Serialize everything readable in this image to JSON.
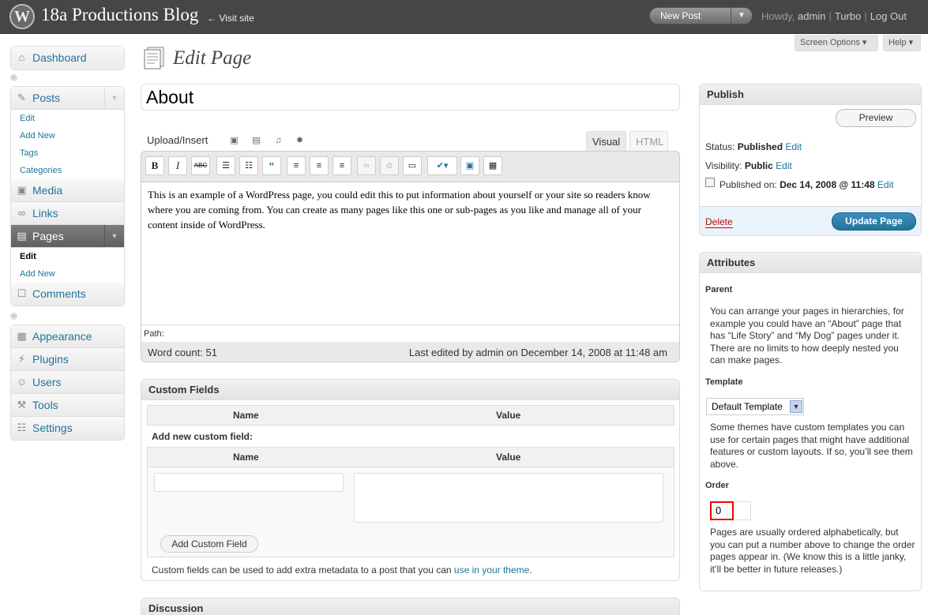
{
  "header": {
    "blog_title": "18a Productions Blog",
    "visit_site": "← Visit site",
    "new_post": "New Post",
    "howdy": "Howdy,",
    "user": "admin",
    "turbo": "Turbo",
    "logout": "Log Out",
    "sep": "|"
  },
  "screen_meta": {
    "screen_options": "Screen Options ▾",
    "help": "Help ▾"
  },
  "menu": {
    "dashboard": "Dashboard",
    "posts": "Posts",
    "posts_sub": [
      "Edit",
      "Add New",
      "Tags",
      "Categories"
    ],
    "media": "Media",
    "links": "Links",
    "pages": "Pages",
    "pages_sub": [
      "Edit",
      "Add New"
    ],
    "comments": "Comments",
    "appearance": "Appearance",
    "plugins": "Plugins",
    "users": "Users",
    "tools": "Tools",
    "settings": "Settings"
  },
  "page": {
    "title": "Edit Page"
  },
  "post": {
    "title": "About"
  },
  "editor": {
    "upload_insert": "Upload/Insert",
    "tab_visual": "Visual",
    "tab_html": "HTML",
    "content": "This is an example of a WordPress page, you could edit this to put information about yourself or your site so readers know where you are coming from. You can create as many pages like this one or sub-pages as you like and manage all of your content inside of WordPress.",
    "path": "Path:",
    "word_count": "Word count: 51",
    "last_edited": "Last edited by admin on December 14, 2008 at 11:48 am"
  },
  "custom_fields": {
    "title": "Custom Fields",
    "col_name": "Name",
    "col_value": "Value",
    "add_new_label": "Add new custom field:",
    "add_button": "Add Custom Field",
    "note_prefix": "Custom fields can be used to add extra metadata to a post that you can",
    "note_link": "use in your theme",
    "note_suffix": "."
  },
  "discussion": {
    "title": "Discussion"
  },
  "publish": {
    "title": "Publish",
    "preview": "Preview",
    "status_label": "Status:",
    "status_value": "Published",
    "visibility_label": "Visibility:",
    "visibility_value": "Public",
    "published_label": "Published on:",
    "published_value": "Dec 14, 2008 @ 11:48",
    "edit": "Edit",
    "delete": "Delete",
    "update": "Update Page"
  },
  "attributes": {
    "title": "Attributes",
    "parent_label": "Parent",
    "parent_help": "You can arrange your pages in hierarchies, for example you could have an “About” page that has “Life Story” and “My Dog” pages under it. There are no limits to how deeply nested you can make pages.",
    "template_label": "Template",
    "template_value": "Default Template",
    "template_help": "Some themes have custom templates you can use for certain pages that might have additional features or custom layouts. If so, you’ll see them above.",
    "order_label": "Order",
    "order_value": "0",
    "order_help": "Pages are usually ordered alphabetically, but you can put a number above to change the order pages appear in. (We know this is a little janky, it’ll be better in future releases.)"
  },
  "colors": {
    "header_bg": "#464646",
    "link": "#21759b",
    "update_btn": "#21759b",
    "delete": "#bc0b0b"
  }
}
